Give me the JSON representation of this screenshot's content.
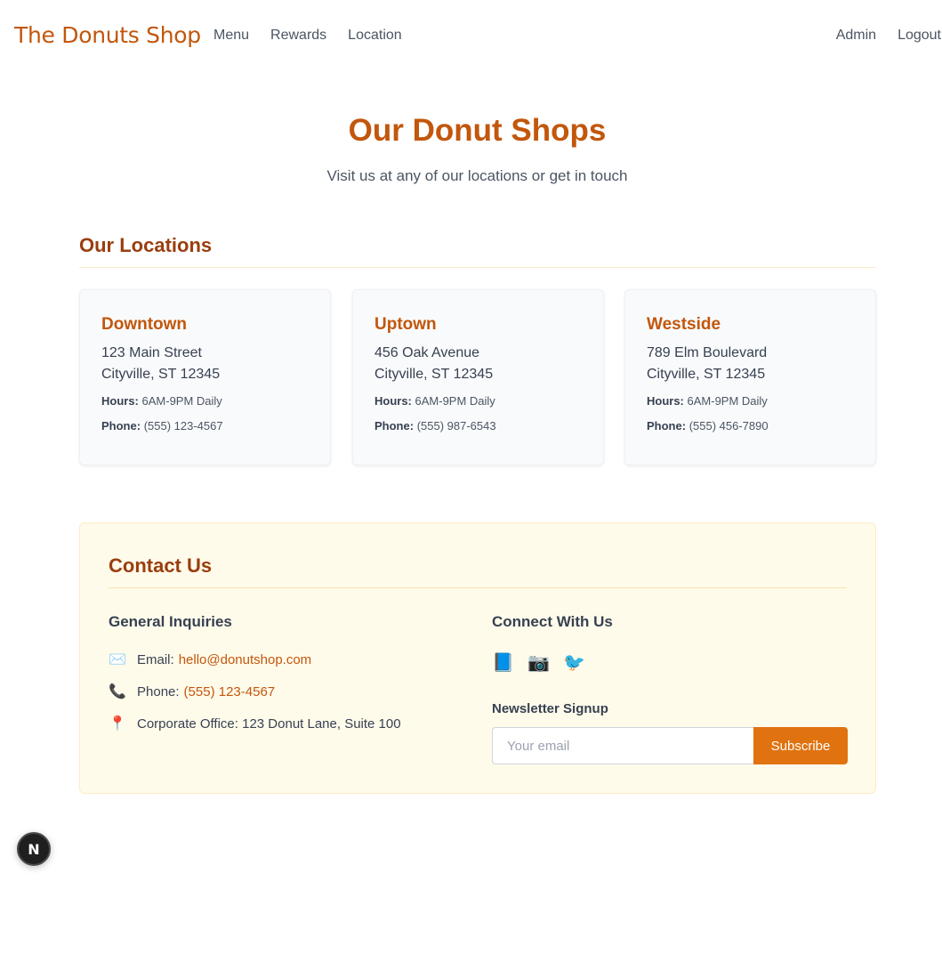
{
  "nav": {
    "brand": "The Donuts Shop",
    "links": [
      "Menu",
      "Rewards",
      "Location"
    ],
    "right": [
      "Admin",
      "Logout"
    ]
  },
  "hero": {
    "title": "Our Donut Shops",
    "subtitle": "Visit us at any of our locations or get in touch"
  },
  "locations": {
    "title": "Our Locations",
    "hours_label": "Hours:",
    "phone_label": "Phone:",
    "items": [
      {
        "name": "Downtown",
        "street": "123 Main Street",
        "city": "Cityville, ST 12345",
        "hours": "6AM-9PM Daily",
        "phone": "(555) 123-4567"
      },
      {
        "name": "Uptown",
        "street": "456 Oak Avenue",
        "city": "Cityville, ST 12345",
        "hours": "6AM-9PM Daily",
        "phone": "(555) 987-6543"
      },
      {
        "name": "Westside",
        "street": "789 Elm Boulevard",
        "city": "Cityville, ST 12345",
        "hours": "6AM-9PM Daily",
        "phone": "(555) 456-7890"
      }
    ]
  },
  "contact": {
    "title": "Contact Us",
    "general_title": "General Inquiries",
    "email_label": "Email:",
    "email": "hello@donutshop.com",
    "phone_label": "Phone:",
    "phone": "(555) 123-4567",
    "office": "Corporate Office: 123 Donut Lane, Suite 100",
    "icons": {
      "email": "✉️",
      "phone": "📞",
      "office": "📍"
    },
    "connect_title": "Connect With Us",
    "social_icons": [
      "📘",
      "📷",
      "🐦"
    ],
    "newsletter_label": "Newsletter Signup",
    "newsletter_placeholder": "Your email",
    "subscribe_label": "Subscribe"
  },
  "badge": {
    "letter": "N"
  },
  "colors": {
    "accent": "#c2570c",
    "button": "#e07310",
    "heading": "#9a3e0e"
  }
}
